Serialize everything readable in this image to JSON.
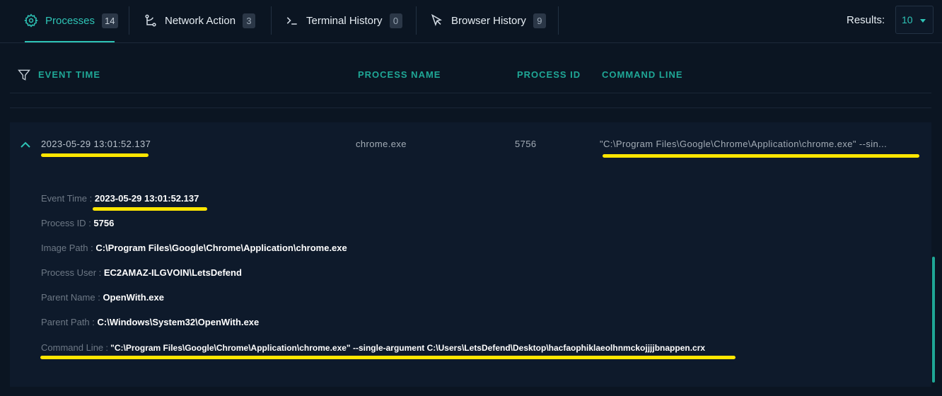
{
  "tabs": [
    {
      "label": "Processes",
      "count": "14",
      "icon": "gear-icon"
    },
    {
      "label": "Network Action",
      "count": "3",
      "icon": "network-icon"
    },
    {
      "label": "Terminal History",
      "count": "0",
      "icon": "terminal-icon"
    },
    {
      "label": "Browser History",
      "count": "9",
      "icon": "cursor-icon"
    }
  ],
  "results": {
    "label": "Results:",
    "value": "10"
  },
  "columns": {
    "event_time": "EVENT TIME",
    "process_name": "PROCESS NAME",
    "process_id": "PROCESS ID",
    "command_line": "COMMAND LINE"
  },
  "row": {
    "event_time": "2023-05-29 13:01:52.137",
    "process_name": "chrome.exe",
    "process_id": "5756",
    "command_line": "\"C:\\Program Files\\Google\\Chrome\\Application\\chrome.exe\" --sin..."
  },
  "details": [
    {
      "key": "Event Time",
      "value": "2023-05-29 13:01:52.137"
    },
    {
      "key": "Process ID",
      "value": "5756"
    },
    {
      "key": "Image Path",
      "value": "C:\\Program Files\\Google\\Chrome\\Application\\chrome.exe"
    },
    {
      "key": "Process User",
      "value": "EC2AMAZ-ILGVOIN\\LetsDefend"
    },
    {
      "key": "Parent Name",
      "value": "OpenWith.exe"
    },
    {
      "key": "Parent Path",
      "value": "C:\\Windows\\System32\\OpenWith.exe"
    },
    {
      "key": "Command Line",
      "value": "\"C:\\Program Files\\Google\\Chrome\\Application\\chrome.exe\" --single-argument C:\\Users\\LetsDefend\\Desktop\\hacfaophiklaeolhnmckojjjjbnappen.crx"
    }
  ],
  "colors": {
    "accent": "#2ec4b6",
    "highlight": "#ffe600",
    "background": "#0b1522"
  }
}
